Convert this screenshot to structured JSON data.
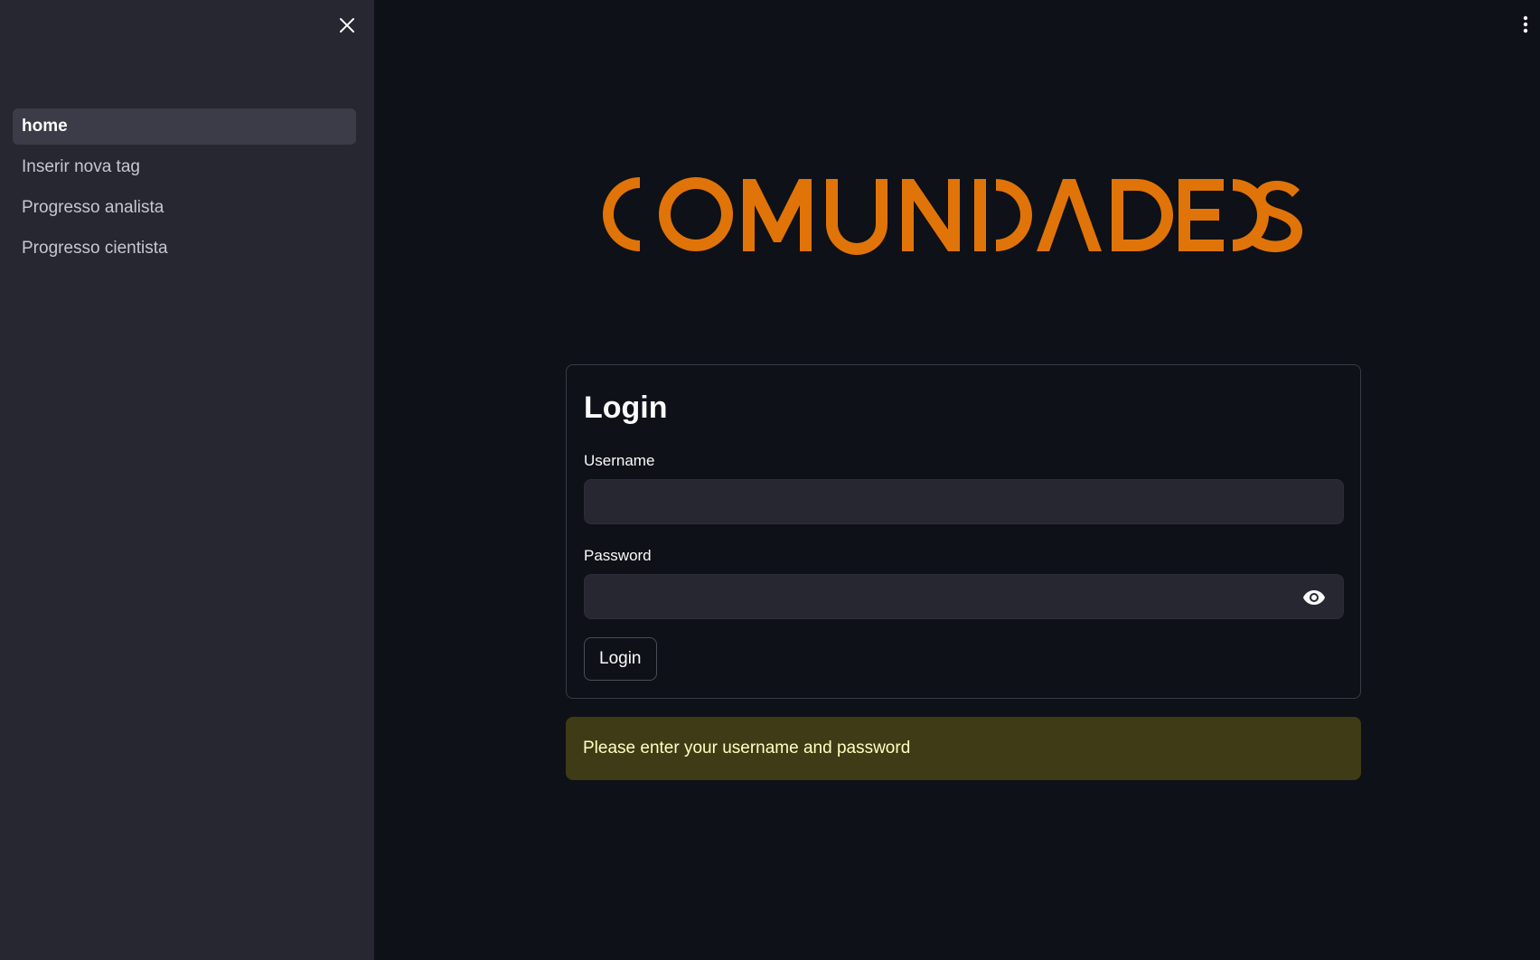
{
  "sidebar": {
    "items": [
      {
        "label": "home",
        "active": true
      },
      {
        "label": "Inserir nova tag",
        "active": false
      },
      {
        "label": "Progresso analista",
        "active": false
      },
      {
        "label": "Progresso cientista",
        "active": false
      }
    ],
    "close_icon": "close-icon"
  },
  "header": {
    "menu_icon": "vertical-ellipsis-icon"
  },
  "logo": {
    "text": "COMUNIDADE DS",
    "color": "#e07408"
  },
  "login": {
    "title": "Login",
    "username_label": "Username",
    "username_value": "",
    "password_label": "Password",
    "password_value": "",
    "password_toggle_icon": "eye-icon",
    "submit_label": "Login"
  },
  "warning": {
    "text": "Please enter your username and password",
    "color": "#3e3b16"
  }
}
